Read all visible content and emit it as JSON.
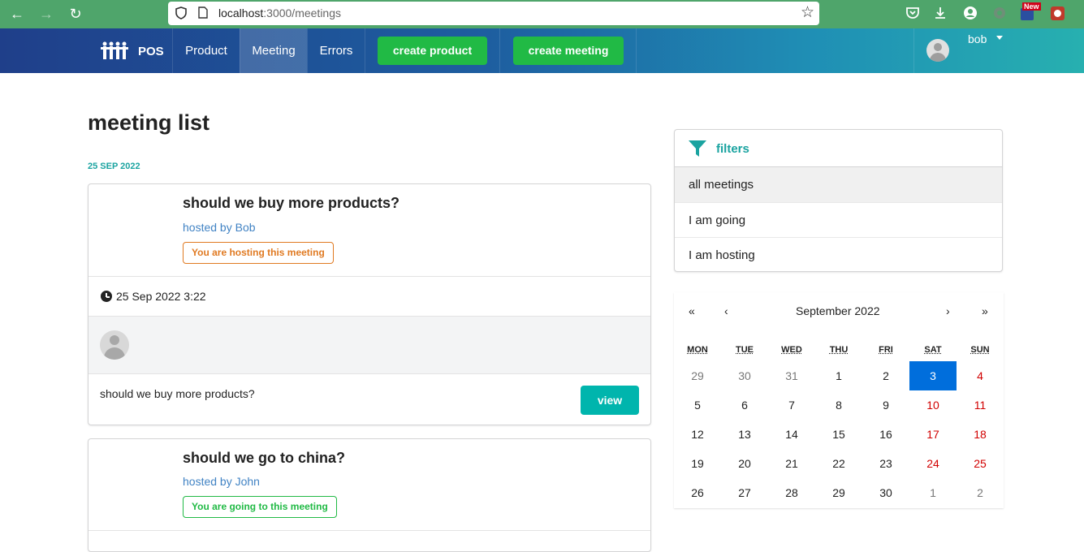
{
  "browser": {
    "url_host": "localhost",
    "url_path": ":3000/meetings",
    "ext_badge": "New"
  },
  "header": {
    "brand": "POS",
    "menu": [
      "Product",
      "Meeting",
      "Errors"
    ],
    "active_menu": "Meeting",
    "create_product": "create product",
    "create_meeting": "create meeting",
    "user_name": "bob"
  },
  "main": {
    "title": "meeting list",
    "date_group": "25 SEP 2022",
    "meetings": [
      {
        "title": "should we buy more products?",
        "hosted_prefix": "hosted by ",
        "host": "Bob",
        "status": "You are hosting this meeting",
        "status_color": "#e07a22",
        "datetime": "25 Sep 2022 3:22",
        "description": "should we buy more products?",
        "view_label": "view"
      },
      {
        "title": "should we go to china?",
        "hosted_prefix": "hosted by ",
        "host": "John",
        "status": "You are going to this meeting",
        "status_color": "#21ba45"
      }
    ]
  },
  "filters": {
    "title": "filters",
    "items": [
      "all meetings",
      "I am going",
      "I am hosting"
    ],
    "active": "all meetings"
  },
  "calendar": {
    "nav_prev_year": "«",
    "nav_prev": "‹",
    "month_label": "September 2022",
    "nav_next": "›",
    "nav_next_year": "»",
    "weekdays": [
      "MON",
      "TUE",
      "WED",
      "THU",
      "FRI",
      "SAT",
      "SUN"
    ],
    "selected_day": "3",
    "weeks": [
      [
        "29",
        "30",
        "31",
        "1",
        "2",
        "3",
        "4"
      ],
      [
        "5",
        "6",
        "7",
        "8",
        "9",
        "10",
        "11"
      ],
      [
        "12",
        "13",
        "14",
        "15",
        "16",
        "17",
        "18"
      ],
      [
        "19",
        "20",
        "21",
        "22",
        "23",
        "24",
        "25"
      ],
      [
        "26",
        "27",
        "28",
        "29",
        "30",
        "1",
        "2"
      ]
    ],
    "colors": {
      "selected": "#006edc",
      "weekend": "#d10000",
      "accent": "#1aa3a0"
    }
  }
}
